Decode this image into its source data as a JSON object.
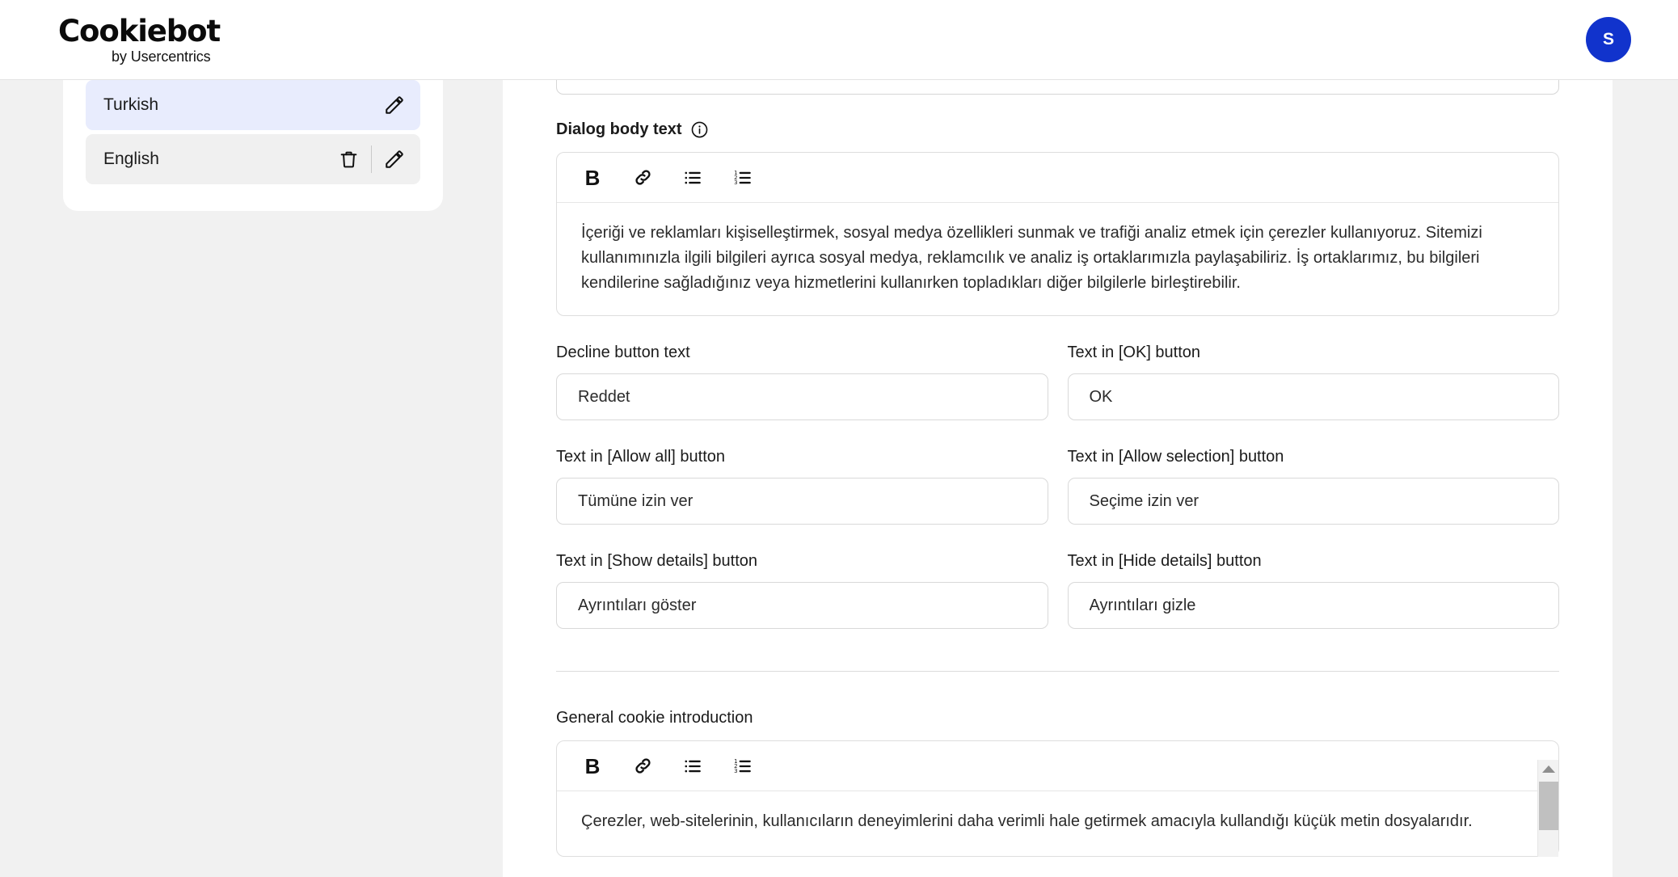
{
  "header": {
    "logo_main": "Cookiebot",
    "logo_sub": "by Usercentrics",
    "avatar_initial": "S"
  },
  "sidebar": {
    "languages": [
      {
        "label": "Turkish",
        "selected": true,
        "has_delete": false
      },
      {
        "label": "English",
        "selected": false,
        "has_delete": true
      }
    ]
  },
  "main": {
    "dialog_body": {
      "label": "Dialog body text",
      "has_info_icon": true,
      "toolbar": [
        {
          "name": "bold",
          "glyph": "B"
        },
        {
          "name": "link",
          "glyph": "link"
        },
        {
          "name": "bullet-list",
          "glyph": "ul"
        },
        {
          "name": "numbered-list",
          "glyph": "ol"
        }
      ],
      "value": "İçeriği ve reklamları kişiselleştirmek, sosyal medya özellikleri sunmak ve trafiği analiz etmek için çerezler kullanıyoruz. Sitemizi kullanımınızla ilgili bilgileri ayrıca sosyal medya, reklamcılık ve analiz iş ortaklarımızla paylaşabiliriz. İş ortaklarımız, bu bilgileri kendilerine sağladığınız veya hizmetlerini kullanırken topladıkları diğer bilgilerle birleştirebilir."
    },
    "fields": [
      {
        "label": "Decline button text",
        "value": "Reddet",
        "placeholder": "Decline button text"
      },
      {
        "label": "Text in [OK] button",
        "value": "OK",
        "placeholder": "Text in [OK] button"
      },
      {
        "label": "Text in [Allow all] button",
        "value": "Tümüne izin ver",
        "placeholder": "Text in [Allow all] button"
      },
      {
        "label": "Text in [Allow selection] button",
        "value": "Seçime izin ver",
        "placeholder": "Text in [Allow selection] button"
      },
      {
        "label": "Text in [Show details] button",
        "value": "Ayrıntıları göster",
        "placeholder": "Text in [Show details] button"
      },
      {
        "label": "Text in [Hide details] button",
        "value": "Ayrıntıları gizle",
        "placeholder": "Text in [Hide details] button"
      }
    ],
    "general_intro": {
      "label": "General cookie introduction",
      "value": "Çerezler, web-sitelerinin, kullanıcıların deneyimlerini daha verimli hale getirmek amacıyla kullandığı küçük metin dosyalarıdır."
    }
  },
  "colors": {
    "accent": "#1133cc",
    "selected_row": "#e8ecfd",
    "plain_row": "#f0f0f0",
    "page_bg": "#f1f1f1"
  }
}
